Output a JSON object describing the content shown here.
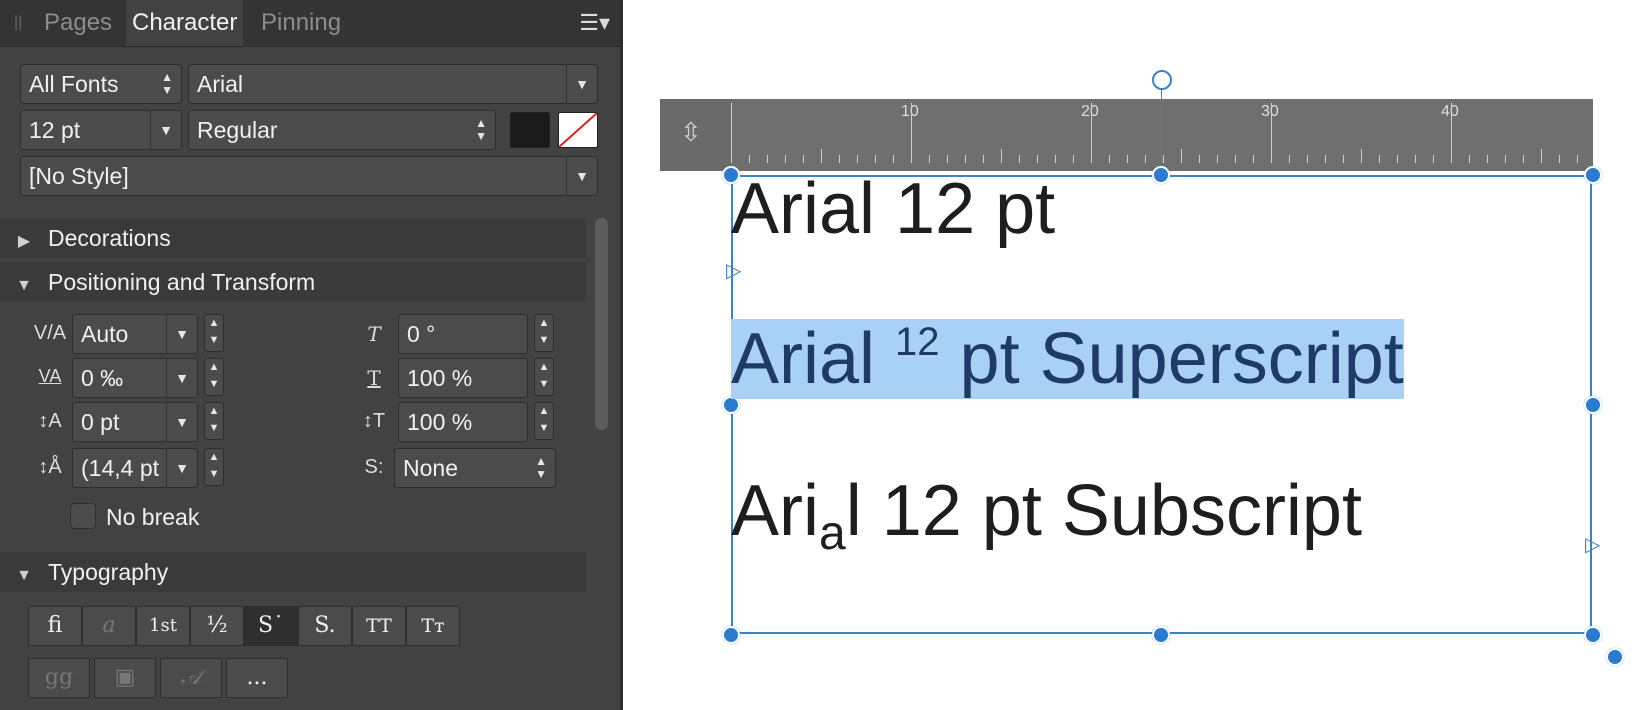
{
  "tabs": [
    {
      "label": "Pages",
      "active": false
    },
    {
      "label": "Character",
      "active": true
    },
    {
      "label": "Pinning",
      "active": false
    }
  ],
  "font": {
    "collection": "All Fonts",
    "family": "Arial",
    "size": "12 pt",
    "weight": "Regular",
    "style": "[No Style]",
    "fill_color": "#1a1a1a",
    "stroke_color": "none"
  },
  "sections": {
    "decorations": "Decorations",
    "positioning": "Positioning and Transform",
    "typography": "Typography"
  },
  "positioning": {
    "kerning": "Auto",
    "tracking": "0 ‰",
    "baseline": "0 pt",
    "leading": "(14,4 pt",
    "shear": "0 °",
    "horizontal_scale": "100 %",
    "vertical_scale": "100 %",
    "script_style": "None",
    "no_break": "No break"
  },
  "typography_buttons_row1": [
    "fi",
    "a",
    "1st",
    "½",
    "S˙",
    "S.",
    "TT",
    "Tᴛ"
  ],
  "typography_buttons_row2": [
    "gg",
    "▣",
    "𝒜",
    "..."
  ],
  "ruler": {
    "labels": [
      "10",
      "20",
      "30",
      "40"
    ]
  },
  "canvas_text": {
    "line1": "Arial 12 pt",
    "line2_start": "Arial ",
    "line2_sup": "12",
    "line2_end": " pt Superscript",
    "line3_start": "Ari",
    "line3_sub": "a",
    "line3_end": "l 12 pt Subscript"
  },
  "colors": {
    "accent": "#2b7bd0",
    "selection": "#a9d1f5",
    "panel_bg": "#424242"
  }
}
